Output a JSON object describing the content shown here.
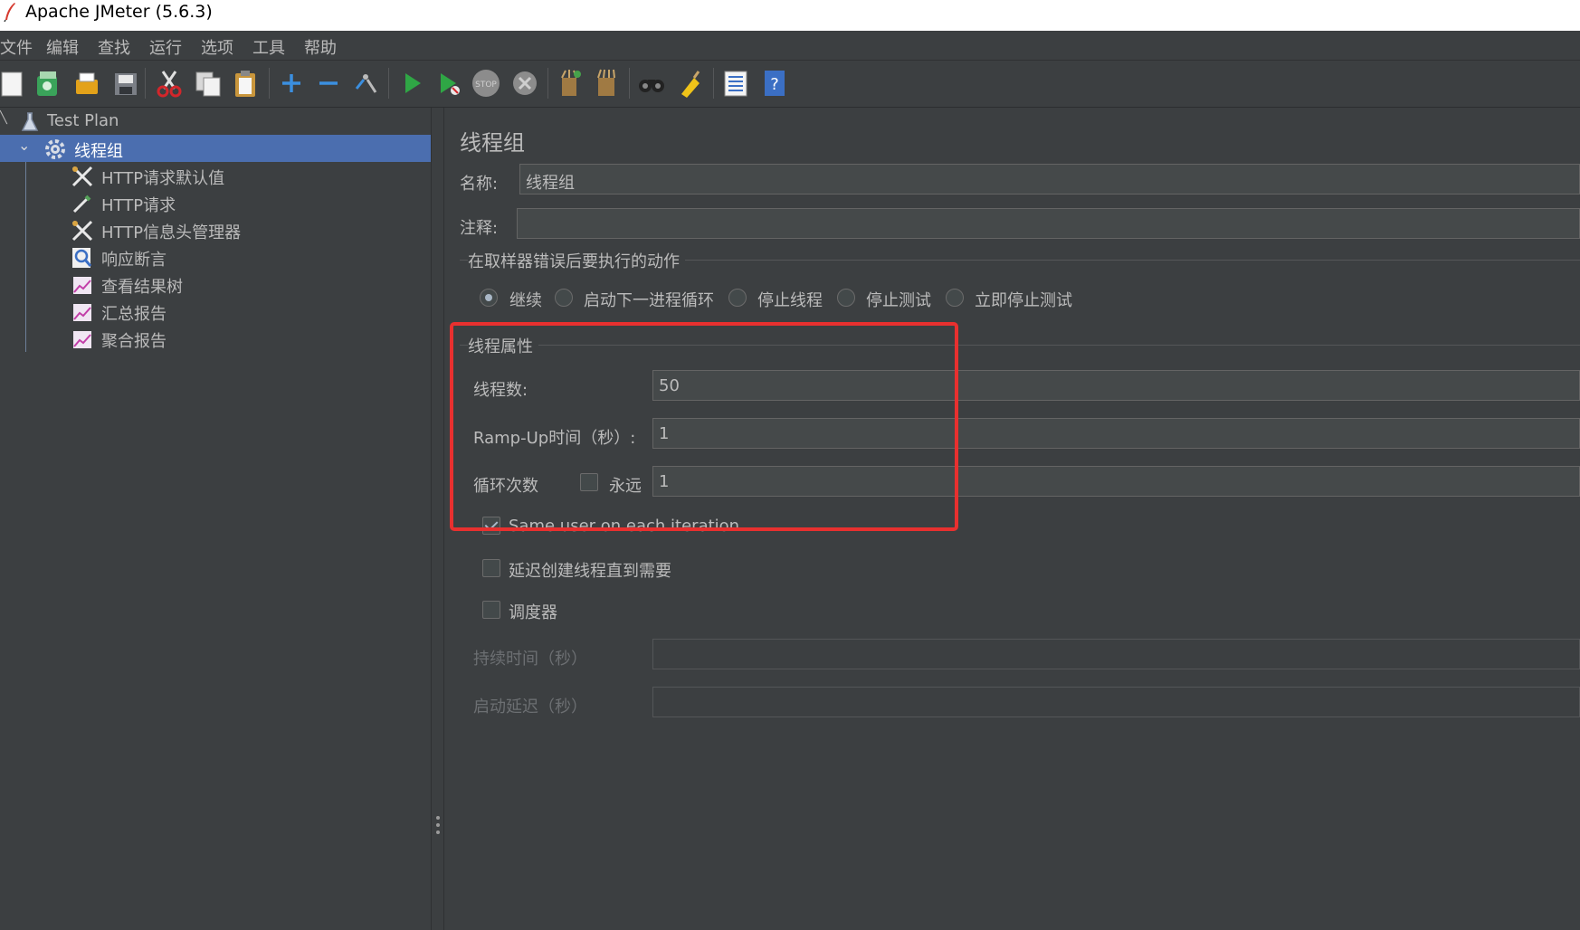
{
  "window": {
    "title": "Apache JMeter (5.6.3)"
  },
  "menu": [
    "文件",
    "编辑",
    "查找",
    "运行",
    "选项",
    "工具",
    "帮助"
  ],
  "toolbar": [
    "new-icon",
    "templates-icon",
    "open-icon",
    "save-icon",
    "cut-icon",
    "copy-icon",
    "paste-icon",
    "expand-icon",
    "collapse-icon",
    "toggle-icon",
    "start-icon",
    "start-no-pause-icon",
    "stop-icon",
    "shutdown-icon",
    "clear-icon",
    "clear-all-icon",
    "search-icon",
    "reset-search-icon",
    "function-helper-icon",
    "help-icon"
  ],
  "tree": {
    "nodes": [
      {
        "label": "Test Plan",
        "icon": "flask-icon"
      },
      {
        "label": "线程组",
        "icon": "gear-icon",
        "selected": true
      },
      {
        "label": "HTTP请求默认值",
        "icon": "wrench-icon"
      },
      {
        "label": "HTTP请求",
        "icon": "pipette-icon"
      },
      {
        "label": "HTTP信息头管理器",
        "icon": "wrench-icon"
      },
      {
        "label": "响应断言",
        "icon": "magnifier-icon"
      },
      {
        "label": "查看结果树",
        "icon": "chart-icon"
      },
      {
        "label": "汇总报告",
        "icon": "chart-icon"
      },
      {
        "label": "聚合报告",
        "icon": "chart-icon"
      }
    ]
  },
  "panel": {
    "title": "线程组",
    "name_label": "名称:",
    "name_value": "线程组",
    "comment_label": "注释:",
    "comment_value": "",
    "error_action": {
      "title": "在取样器错误后要执行的动作",
      "options": [
        "继续",
        "启动下一进程循环",
        "停止线程",
        "停止测试",
        "立即停止测试"
      ],
      "selected": "继续"
    },
    "thread_props": {
      "title": "线程属性",
      "threads_label": "线程数:",
      "threads_value": "50",
      "rampup_label": "Ramp-Up时间（秒）:",
      "rampup_value": "1",
      "loop_label": "循环次数",
      "forever_label": "永远",
      "forever_checked": false,
      "loop_value": "1",
      "same_user_label": "Same user on each iteration",
      "same_user_checked": true
    },
    "delay_create_label": "延迟创建线程直到需要",
    "delay_create_checked": false,
    "scheduler_label": "调度器",
    "scheduler_checked": false,
    "duration_label": "持续时间（秒）",
    "duration_value": "",
    "startup_delay_label": "启动延迟（秒）",
    "startup_delay_value": ""
  },
  "colors": {
    "highlight": "#e8302f",
    "selection": "#4b6eaf",
    "background": "#3c3f41"
  }
}
